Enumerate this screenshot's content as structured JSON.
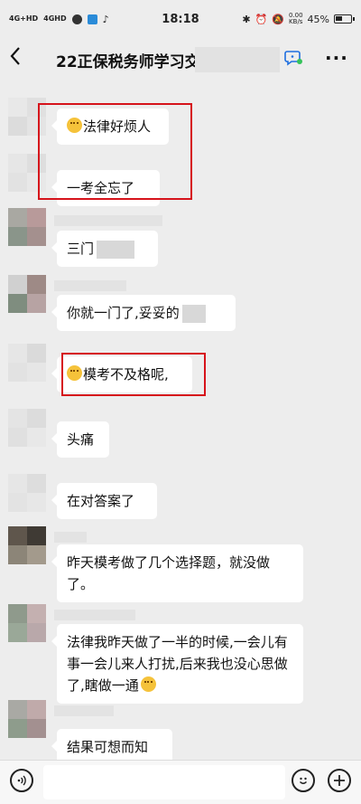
{
  "status": {
    "net1": "4G+HD",
    "net2": "4GHD",
    "time": "18:18",
    "speed_value": "0.00",
    "speed_unit": "KB/s",
    "battery": "45%"
  },
  "header": {
    "title": "22正保税务师学习交"
  },
  "messages": [
    {
      "text": "法律好烦人",
      "emoji": "grimacing-emoji",
      "highlighted": true
    },
    {
      "text": "一考全忘了",
      "highlighted": true
    },
    {
      "text": "三门",
      "redacted_tail": true
    },
    {
      "text": "你就一门了,妥妥的",
      "redacted_tail": true
    },
    {
      "text": "模考不及格呢,",
      "emoji": "grimacing-emoji",
      "highlighted": true
    },
    {
      "text": "头痛"
    },
    {
      "text": "在对答案了"
    },
    {
      "text": "昨天模考做了几个选择题，就没做了。"
    },
    {
      "text": "法律我昨天做了一半的时候,一会儿有事一会儿来人打扰,后来我也没心思做了,瞎做一通",
      "emoji_tail": "tongue-emoji"
    },
    {
      "text": "结果可想而知"
    }
  ],
  "colors": {
    "highlight": "#d6131b",
    "background": "#ededed",
    "bubble": "#ffffff"
  }
}
